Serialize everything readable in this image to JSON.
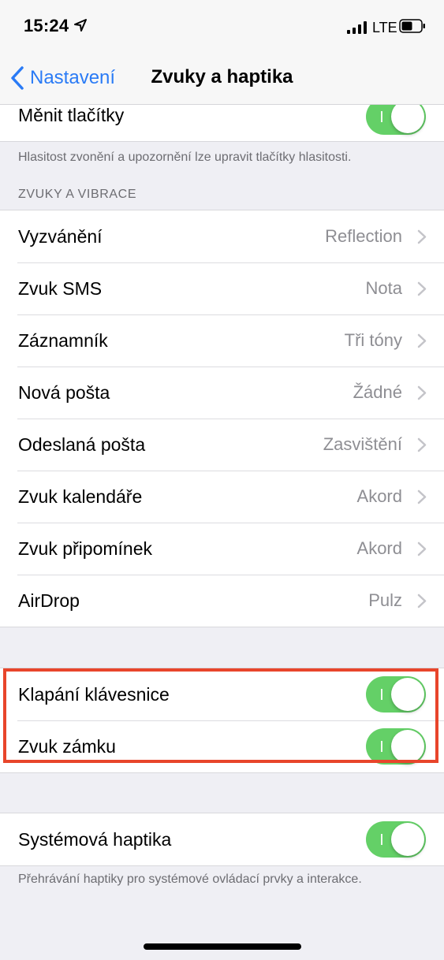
{
  "status": {
    "time": "15:24",
    "network": "LTE"
  },
  "nav": {
    "back_label": "Nastavení",
    "title": "Zvuky a haptika"
  },
  "top_group": {
    "change_buttons": {
      "label": "Měnit tlačítky",
      "on": true
    }
  },
  "top_footer": "Hlasitost zvonění a upozornění lze upravit tlačítky hlasitosti.",
  "sounds_header": "ZVUKY A VIBRACE",
  "sounds": [
    {
      "label": "Vyzvánění",
      "value": "Reflection"
    },
    {
      "label": "Zvuk SMS",
      "value": "Nota"
    },
    {
      "label": "Záznamník",
      "value": "Tři tóny"
    },
    {
      "label": "Nová pošta",
      "value": "Žádné"
    },
    {
      "label": "Odeslaná pošta",
      "value": "Zasvištění"
    },
    {
      "label": "Zvuk kalendáře",
      "value": "Akord"
    },
    {
      "label": "Zvuk připomínek",
      "value": "Akord"
    },
    {
      "label": "AirDrop",
      "value": "Pulz"
    }
  ],
  "keyboard_group": [
    {
      "label": "Klapání klávesnice",
      "on": true
    },
    {
      "label": "Zvuk zámku",
      "on": true
    }
  ],
  "haptics_group": {
    "system_haptics": {
      "label": "Systémová haptika",
      "on": true
    }
  },
  "haptics_footer": "Přehrávání haptiky pro systémové ovládací prvky a interakce.",
  "colors": {
    "accent": "#2a7bf6",
    "toggle_on": "#64d067",
    "highlight": "#e8452b",
    "background": "#efeff4"
  }
}
